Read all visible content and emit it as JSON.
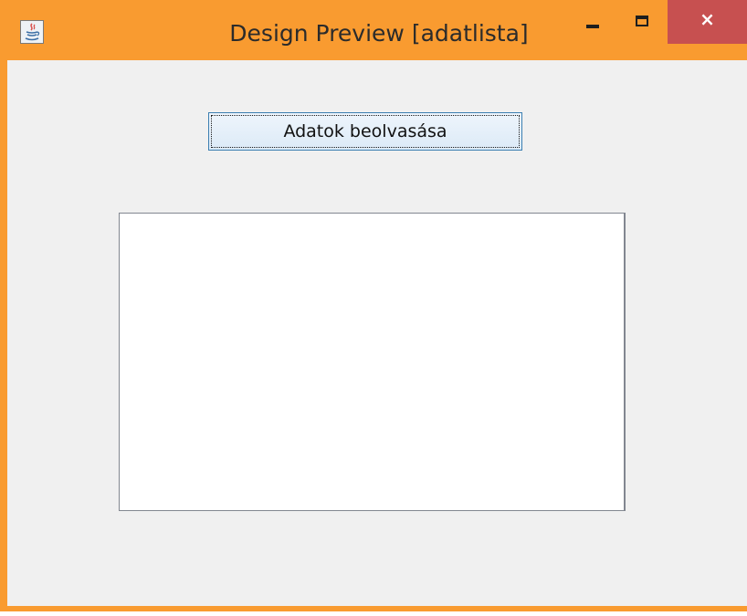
{
  "window": {
    "title": "Design Preview [adatlista]",
    "title_bar_color": "#f99b30",
    "close_button_color": "#c75050",
    "controls": {
      "minimize": "minimize-icon",
      "maximize": "maximize-icon",
      "close": "×"
    },
    "app_icon": "java-icon"
  },
  "main": {
    "read_button_label": "Adatok beolvasása",
    "list_items": []
  }
}
